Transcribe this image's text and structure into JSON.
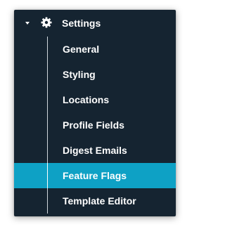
{
  "menu": {
    "title": "Settings",
    "title_icon": "gear-icon",
    "expand_icon": "caret-down-icon",
    "items": [
      {
        "label": "General"
      },
      {
        "label": "Styling"
      },
      {
        "label": "Locations"
      },
      {
        "label": "Profile Fields"
      },
      {
        "label": "Digest Emails"
      },
      {
        "label": "Feature Flags",
        "active": true
      },
      {
        "label": "Template Editor"
      }
    ]
  },
  "colors": {
    "panel_background": "#152431",
    "active_background": "#0ea1c5",
    "text": "#ffffff",
    "tree_line": "#cfd6dc"
  }
}
